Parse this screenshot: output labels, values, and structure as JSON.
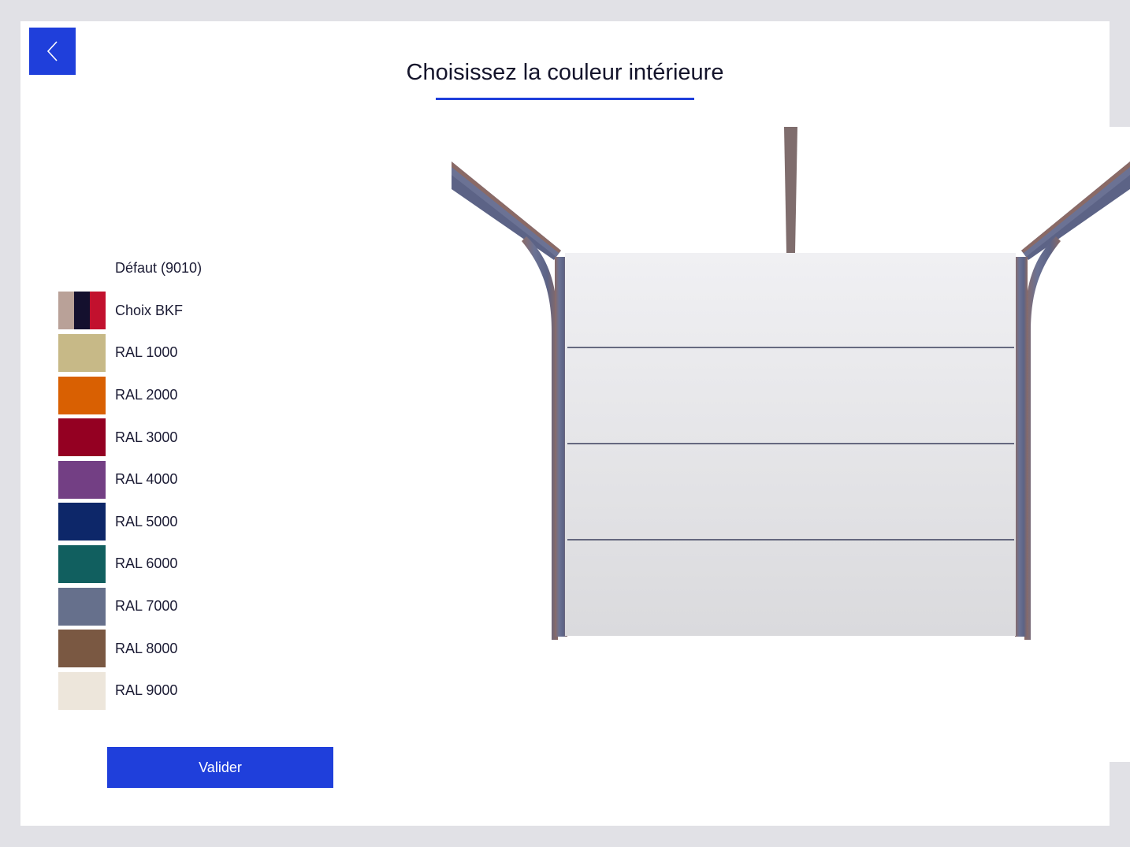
{
  "header": {
    "title": "Choisissez la couleur intérieure",
    "accent_color": "#1f3fdb"
  },
  "back_button": {
    "icon": "chevron-left-icon"
  },
  "colors": [
    {
      "label": "Défaut (9010)",
      "swatch": null
    },
    {
      "label": "Choix BKF",
      "swatch": [
        "#b9a198",
        "#14102e",
        "#c2112e"
      ]
    },
    {
      "label": "RAL 1000",
      "swatch": "#c7b987"
    },
    {
      "label": "RAL 2000",
      "swatch": "#d96002"
    },
    {
      "label": "RAL 3000",
      "swatch": "#940022"
    },
    {
      "label": "RAL 4000",
      "swatch": "#733f84"
    },
    {
      "label": "RAL 5000",
      "swatch": "#0d2769"
    },
    {
      "label": "RAL 6000",
      "swatch": "#115f5f"
    },
    {
      "label": "RAL 7000",
      "swatch": "#66708c"
    },
    {
      "label": "RAL 8000",
      "swatch": "#7a5842"
    },
    {
      "label": "RAL 9000",
      "swatch": "#ede6db"
    }
  ],
  "footer": {
    "validate_label": "Valider"
  },
  "preview": {
    "door_color": "#e7e7ea",
    "rail_color": "#6b7294",
    "rail_edge_color": "#8a6a66",
    "panel_count": 4
  }
}
